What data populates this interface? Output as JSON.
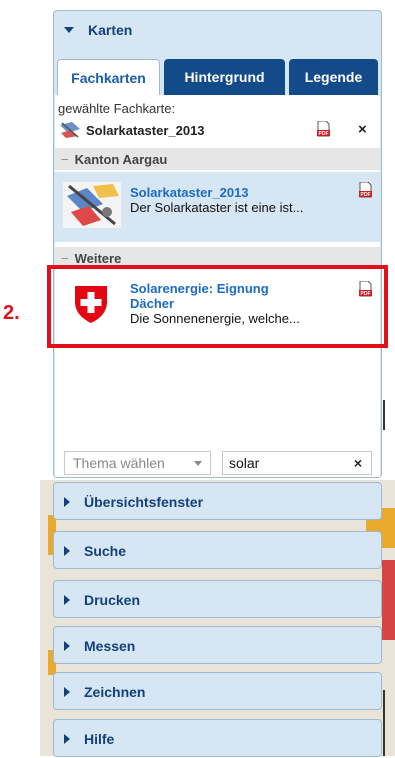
{
  "karten_panel": {
    "title": "Karten",
    "tabs": [
      {
        "label": "Fachkarten",
        "active": true
      },
      {
        "label": "Hintergrund",
        "active": false
      },
      {
        "label": "Legende",
        "active": false
      }
    ],
    "selected": {
      "label": "gewählte Fachkarte:",
      "name": "Solarkataster_2013"
    },
    "groups": [
      {
        "name": "Kanton Aargau",
        "items": [
          {
            "title": "Solarkataster_2013",
            "description": "Der Solarkataster ist eine ist..."
          }
        ]
      },
      {
        "name": "Weitere",
        "items": [
          {
            "title_line1": "Solarenergie: Eignung",
            "title_line2": "Dächer",
            "description": "Die Sonnenenergie, welche..."
          }
        ]
      }
    ],
    "theme_select": {
      "placeholder": "Thema wählen"
    },
    "search": {
      "value": "solar"
    }
  },
  "annotation": {
    "step_label": "2."
  },
  "collapsed_panels": [
    {
      "title": "Übersichtsfenster"
    },
    {
      "title": "Suche"
    },
    {
      "title": "Drucken"
    },
    {
      "title": "Messen"
    },
    {
      "title": "Zeichnen"
    },
    {
      "title": "Hilfe"
    }
  ],
  "colors": {
    "accent": "#1b6cc5",
    "highlight": "#e2101a",
    "tab_dark": "#134a8a",
    "panel": "#d7e6f3"
  }
}
